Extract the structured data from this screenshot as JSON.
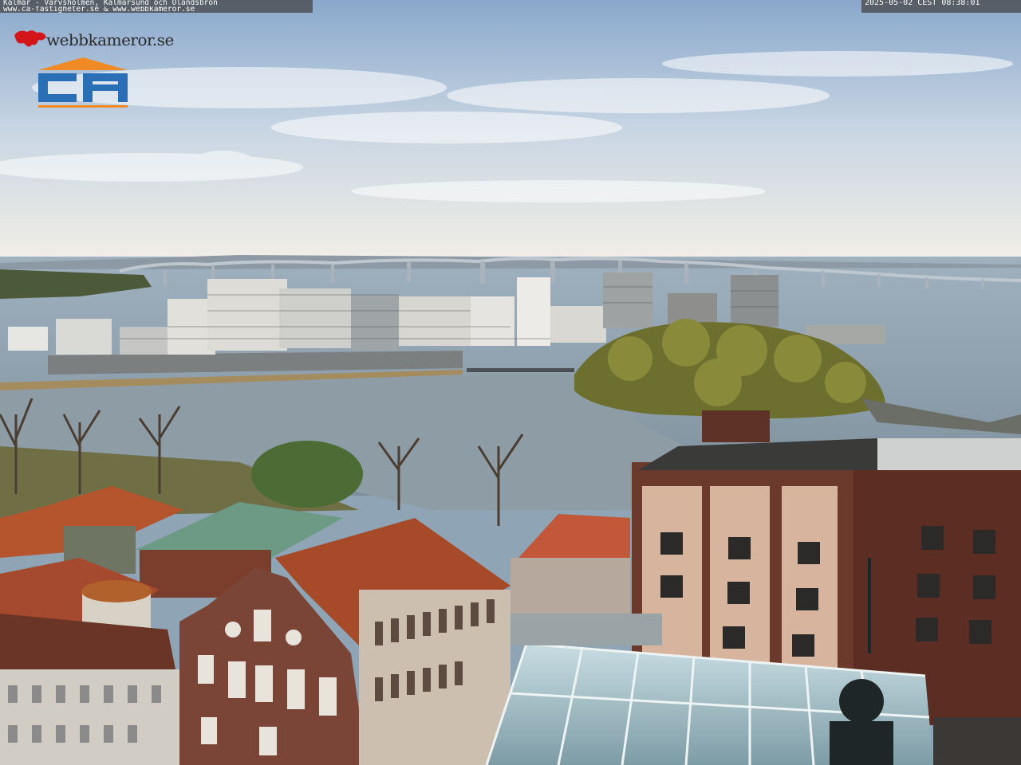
{
  "overlay": {
    "title_line1": "Kalmar - Varvsholmen, Kalmarsund och Ölandsbron",
    "title_line2": "www.ca-fastigheter.se & www.webbkameror.se",
    "timestamp": "2025-05-02 CEST 08:38:01"
  },
  "brand": {
    "webcam_logo_text": "webbkameror.se",
    "sponsor_logo_text": "CA"
  },
  "colors": {
    "sky_top": "#8aa8cc",
    "sky_horizon": "#f2efe6",
    "water": "#8a9aa8",
    "roof_red": "#b5552e",
    "roof_green": "#6d9a84",
    "brick": "#6b3a2c",
    "logo_orange": "#f08a24",
    "logo_blue": "#2a6fb5"
  }
}
